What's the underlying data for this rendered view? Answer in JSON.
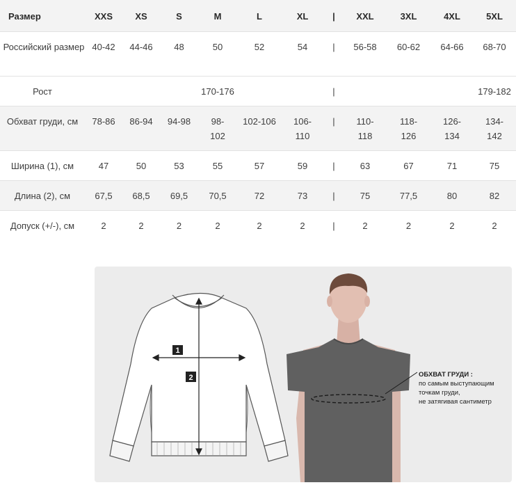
{
  "table": {
    "header": [
      "Размер",
      "XXS",
      "XS",
      "S",
      "M",
      "L",
      "XL",
      "|",
      "XXL",
      "3XL",
      "4XL",
      "5XL"
    ],
    "rows": [
      {
        "label": "Российский размер",
        "cells": [
          "40-42",
          "44-46",
          "48",
          "50",
          "52",
          "54",
          "|",
          "56-58",
          "60-62",
          "64-66",
          "68-70"
        ]
      },
      {
        "label": "Рост",
        "cells": [
          "",
          "",
          "",
          "170-176",
          "",
          "",
          "|",
          "",
          "",
          "",
          "179-182"
        ]
      },
      {
        "label": "Обхват груди, см",
        "cells": [
          "78-86",
          "86-94",
          "94-98",
          "98-102",
          "102-106",
          "106-110",
          "|",
          "110-118",
          "118-126",
          "126-134",
          "134-142"
        ]
      },
      {
        "label": "Ширина (1), см",
        "cells": [
          "47",
          "50",
          "53",
          "55",
          "57",
          "59",
          "|",
          "63",
          "67",
          "71",
          "75"
        ]
      },
      {
        "label": "Длина (2), см",
        "cells": [
          "67,5",
          "68,5",
          "69,5",
          "70,5",
          "72",
          "73",
          "|",
          "75",
          "77,5",
          "80",
          "82"
        ]
      },
      {
        "label": "Допуск (+/-), см",
        "cells": [
          "2",
          "2",
          "2",
          "2",
          "2",
          "2",
          "|",
          "2",
          "2",
          "2",
          "2"
        ]
      }
    ]
  },
  "diagram": {
    "marker_width": "1",
    "marker_length": "2",
    "chest_title": "ОБХВАТ ГРУДИ :",
    "chest_line1": "по самым выступающим",
    "chest_line2": "точкам груди,",
    "chest_line3": "не затягивая сантиметр"
  }
}
